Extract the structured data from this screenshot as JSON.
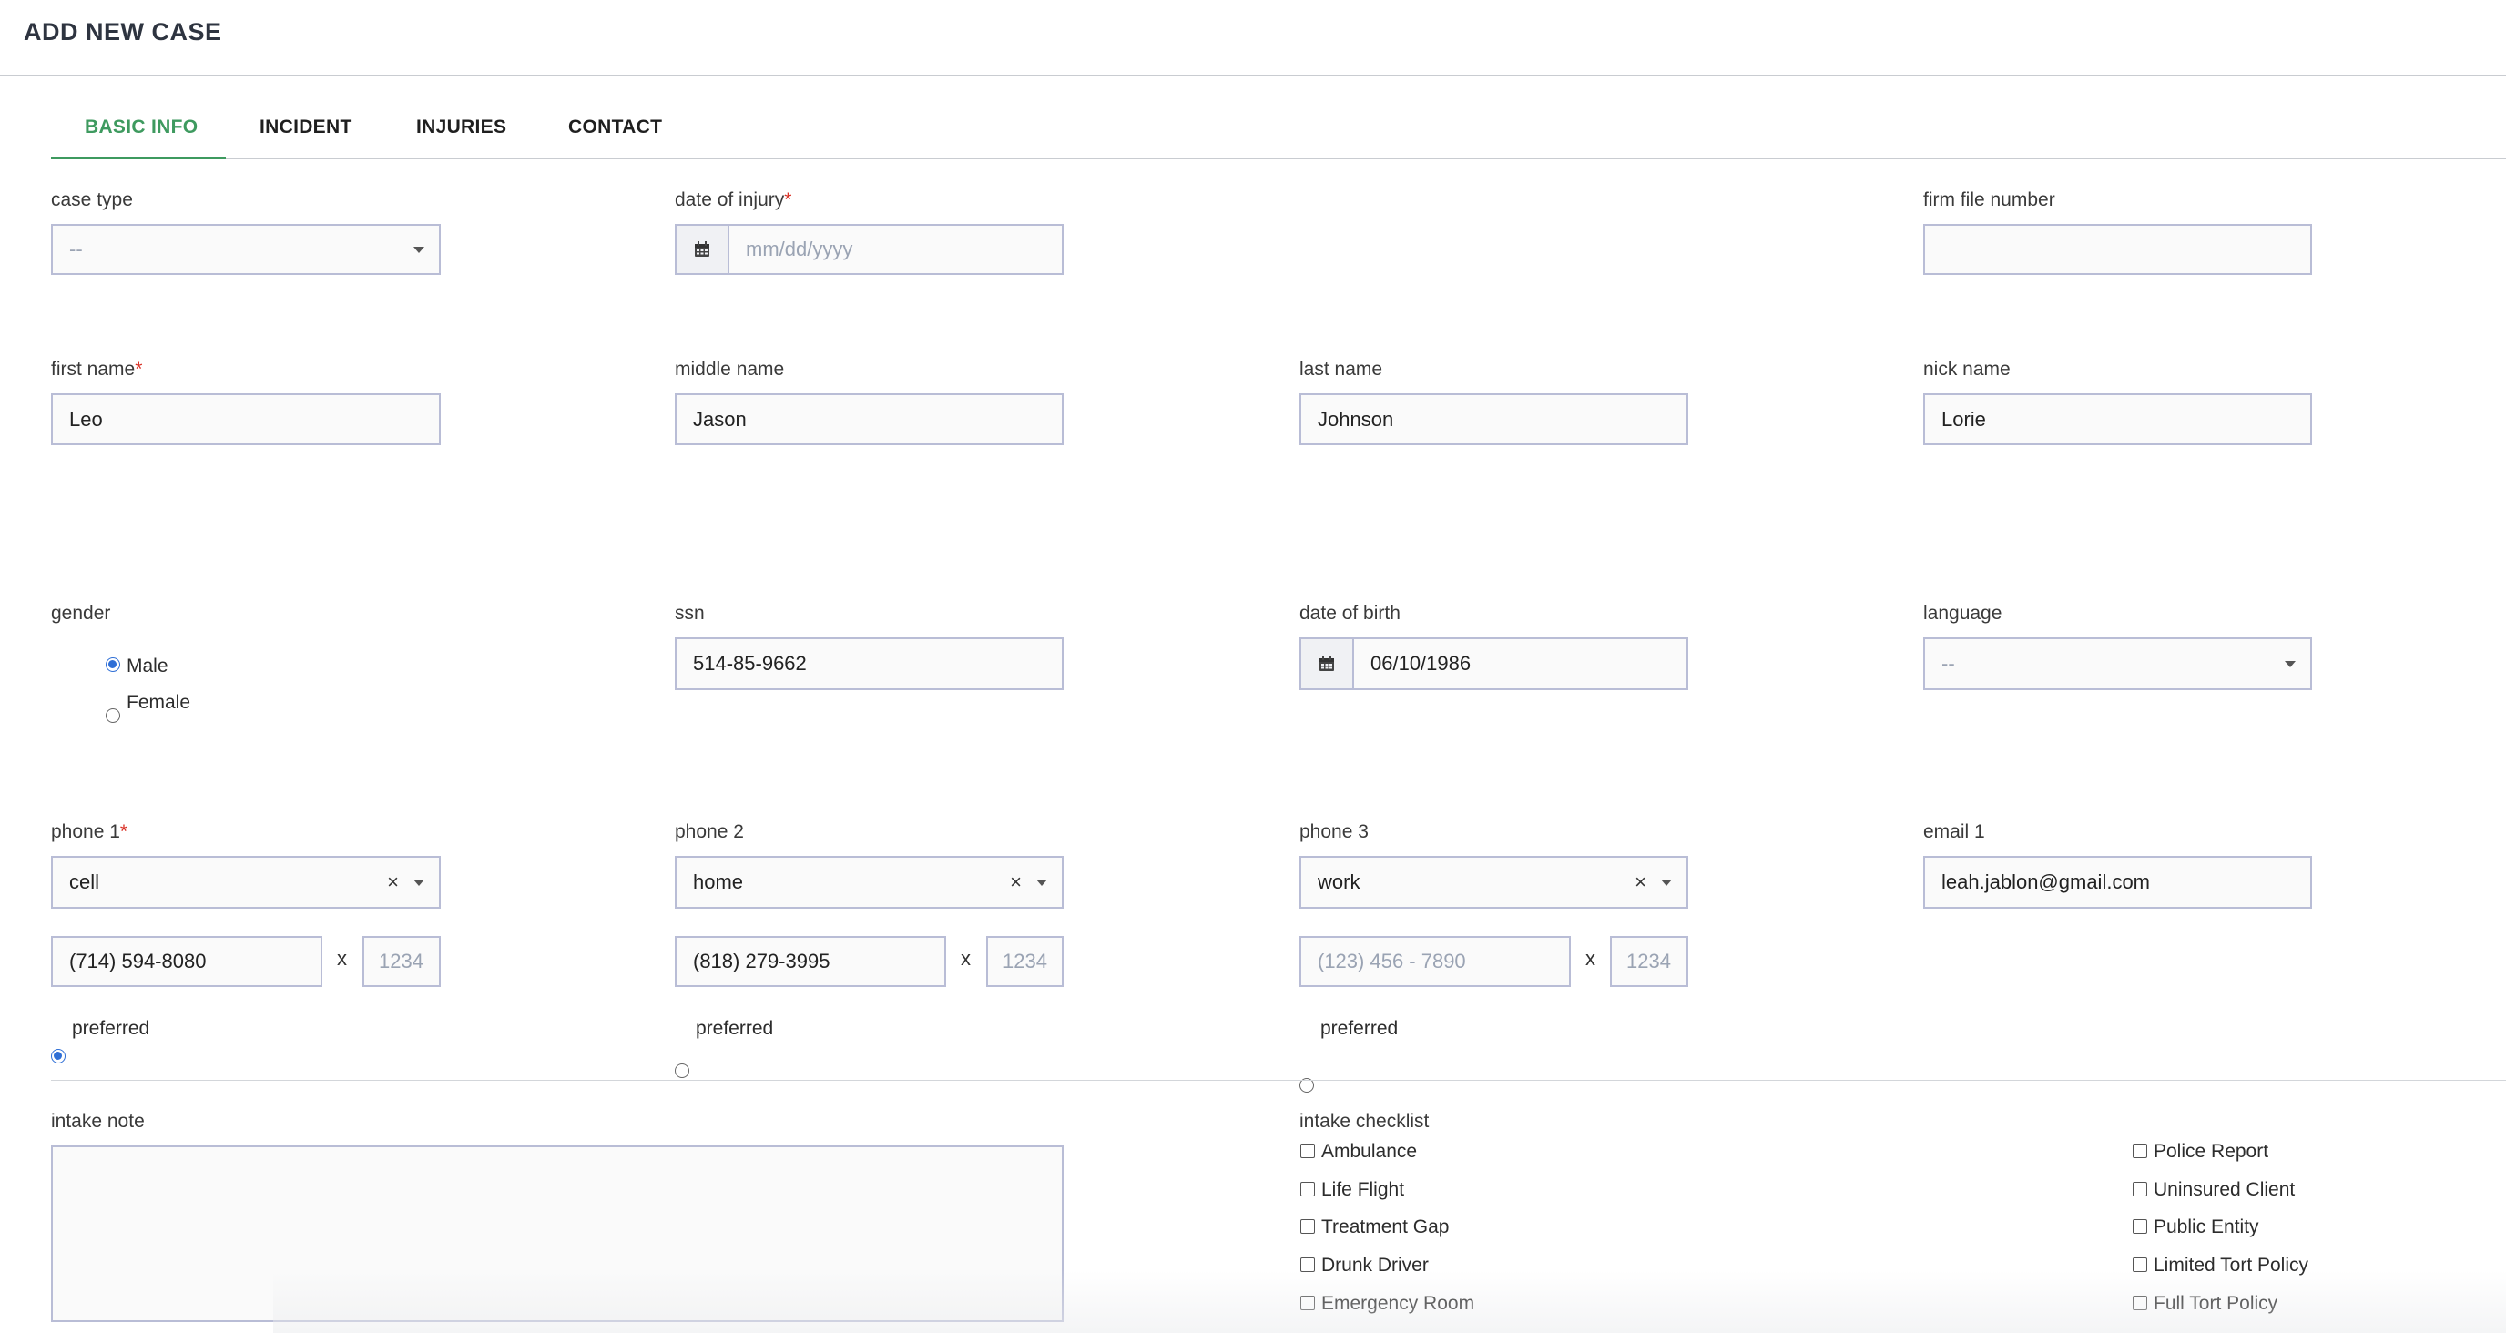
{
  "header": {
    "title": "ADD NEW CASE"
  },
  "tabs": [
    {
      "label": "BASIC INFO",
      "active": true
    },
    {
      "label": "INCIDENT",
      "active": false
    },
    {
      "label": "INJURIES",
      "active": false
    },
    {
      "label": "CONTACT",
      "active": false
    }
  ],
  "fields": {
    "case_type": {
      "label": "case type",
      "value": "--",
      "icon": "chevron-down-icon"
    },
    "date_of_injury": {
      "label": "date of injury",
      "required_mark": "*",
      "placeholder": "mm/dd/yyyy",
      "icon": "calendar-icon"
    },
    "firm_file_number": {
      "label": "firm file number",
      "value": ""
    },
    "first_name": {
      "label": "first name",
      "required_mark": "*",
      "value": "Leo"
    },
    "middle_name": {
      "label": "middle name",
      "value": "Jason"
    },
    "last_name": {
      "label": "last name",
      "value": "Johnson"
    },
    "nick_name": {
      "label": "nick name",
      "value": "Lorie"
    },
    "gender": {
      "label": "gender",
      "options": [
        "Male",
        "Female"
      ],
      "selected": "Male"
    },
    "ssn": {
      "label": "ssn",
      "value": "514-85-9662"
    },
    "date_of_birth": {
      "label": "date of birth",
      "value": "06/10/1986",
      "icon": "calendar-icon"
    },
    "language": {
      "label": "language",
      "value": "--",
      "icon": "chevron-down-icon"
    },
    "email_1": {
      "label": "email 1",
      "value": "leah.jablon@gmail.com"
    }
  },
  "phones": [
    {
      "label": "phone 1",
      "required_mark": "*",
      "type": "cell",
      "number": "(714) 594-8080",
      "number_placeholder": "(123) 456 - 7890",
      "ext_placeholder": "1234",
      "x": "x",
      "clear": "×",
      "preferred_label": "preferred",
      "preferred": true
    },
    {
      "label": "phone 2",
      "required_mark": "",
      "type": "home",
      "number": "(818) 279-3995",
      "number_placeholder": "(123) 456 - 7890",
      "ext_placeholder": "1234",
      "x": "x",
      "clear": "×",
      "preferred_label": "preferred",
      "preferred": false
    },
    {
      "label": "phone 3",
      "required_mark": "",
      "type": "work",
      "number": "",
      "number_placeholder": "(123) 456 - 7890",
      "ext_placeholder": "1234",
      "x": "x",
      "clear": "×",
      "preferred_label": "preferred",
      "preferred": false
    }
  ],
  "intake": {
    "note_label": "intake note",
    "checklist_label": "intake checklist",
    "checklist_left": [
      "Ambulance",
      "Life Flight",
      "Treatment Gap",
      "Drunk Driver",
      "Emergency Room"
    ],
    "checklist_right": [
      "Police Report",
      "Uninsured Client",
      "Public Entity",
      "Limited Tort Policy",
      "Full Tort Policy"
    ]
  },
  "colors": {
    "accent": "#3e9a5f",
    "required": "#d93025",
    "radio_selected": "#2f6fd6",
    "input_border": "#b9bdd6"
  }
}
